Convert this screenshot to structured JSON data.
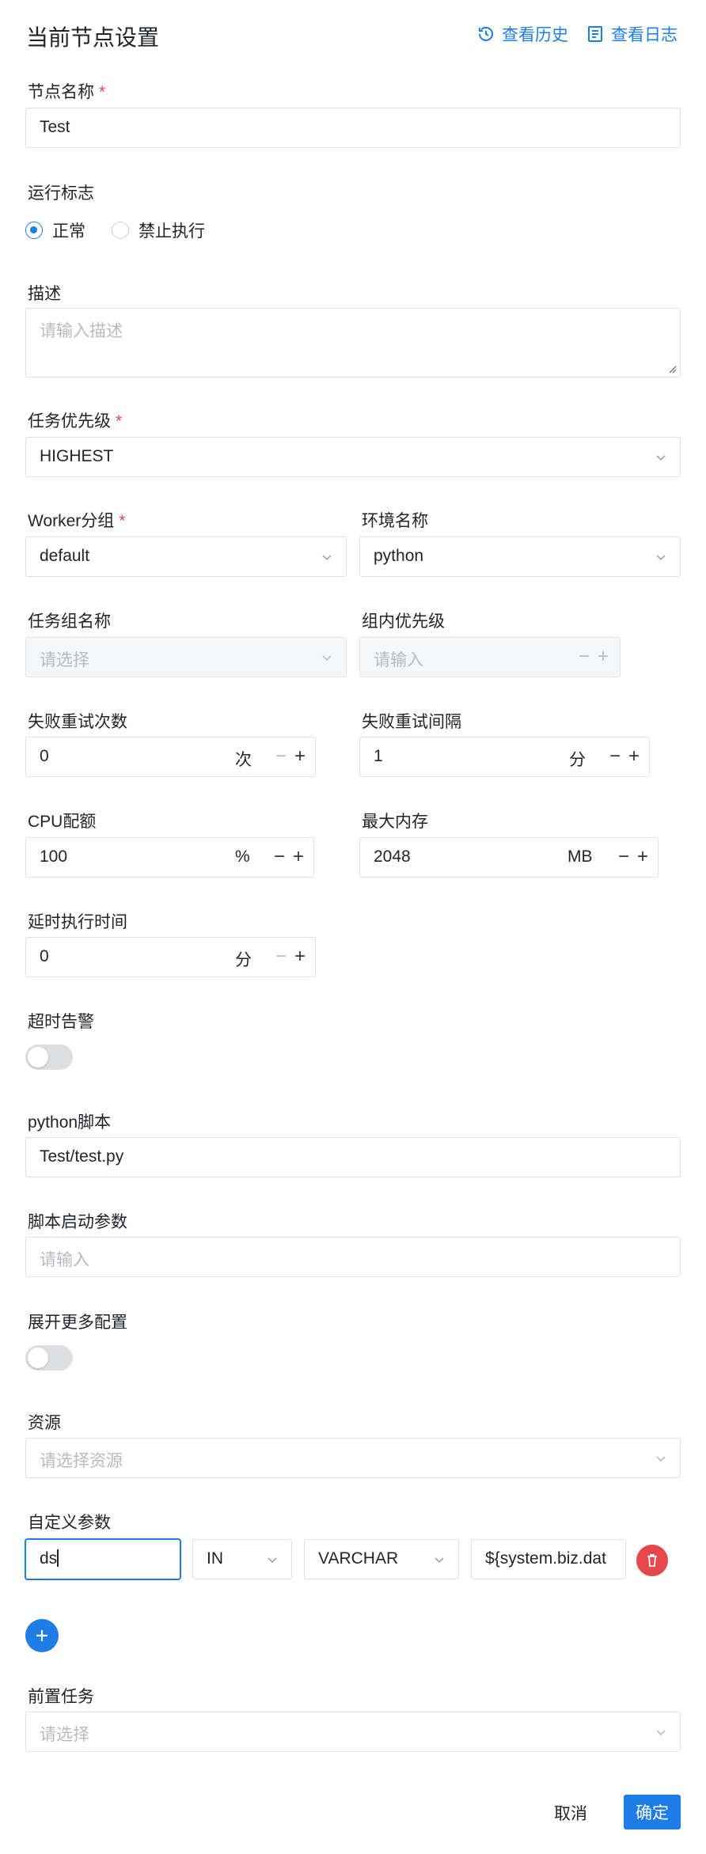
{
  "header": {
    "title": "当前节点设置",
    "history_label": "查看历史",
    "log_label": "查看日志",
    "accent": "#1e7ce6"
  },
  "node_name": {
    "label": "节点名称",
    "value": "Test"
  },
  "run_flag": {
    "label": "运行标志",
    "options": [
      "正常",
      "禁止执行"
    ],
    "selected": "正常"
  },
  "description": {
    "label": "描述",
    "placeholder": "请输入描述"
  },
  "task_priority": {
    "label": "任务优先级",
    "value": "HIGHEST"
  },
  "worker_group": {
    "label": "Worker分组",
    "value": "default"
  },
  "environment": {
    "label": "环境名称",
    "value": "python"
  },
  "task_group": {
    "label": "任务组名称",
    "placeholder": "请选择"
  },
  "group_priority": {
    "label": "组内优先级",
    "placeholder": "请输入"
  },
  "retry_times": {
    "label": "失败重试次数",
    "value": "0",
    "unit": "次"
  },
  "retry_interval": {
    "label": "失败重试间隔",
    "value": "1",
    "unit": "分"
  },
  "cpu_quota": {
    "label": "CPU配额",
    "value": "100",
    "unit": "%"
  },
  "max_memory": {
    "label": "最大内存",
    "value": "2048",
    "unit": "MB"
  },
  "delay_time": {
    "label": "延时执行时间",
    "value": "0",
    "unit": "分"
  },
  "timeout_alarm": {
    "label": "超时告警",
    "enabled": false
  },
  "python_script": {
    "label": "python脚本",
    "value": "Test/test.py"
  },
  "script_args": {
    "label": "脚本启动参数",
    "placeholder": "请输入"
  },
  "more_config": {
    "label": "展开更多配置",
    "enabled": false
  },
  "resources": {
    "label": "资源",
    "placeholder": "请选择资源"
  },
  "custom_params": {
    "label": "自定义参数",
    "rows": [
      {
        "prop": "ds",
        "direct": "IN",
        "type": "VARCHAR",
        "value": "${system.biz.dat"
      }
    ]
  },
  "pre_tasks": {
    "label": "前置任务",
    "placeholder": "请选择"
  },
  "footer": {
    "cancel_label": "取消",
    "confirm_label": "确定"
  }
}
